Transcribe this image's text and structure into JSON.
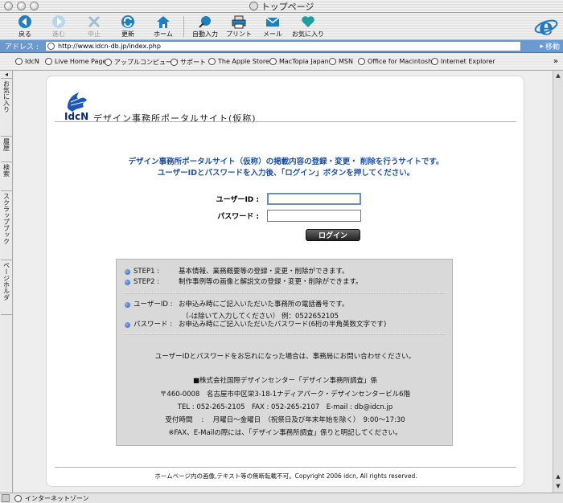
{
  "window": {
    "title": "トップページ"
  },
  "toolbar": {
    "back": "戻る",
    "forward": "進む",
    "stop": "中止",
    "refresh": "更新",
    "home": "ホーム",
    "autofill": "自動入力",
    "print": "プリント",
    "mail": "メール",
    "favorites": "お気に入り"
  },
  "address": {
    "label": "アドレス :",
    "url": "http://www.idcn-db.jp/index.php",
    "go": "移動"
  },
  "favbar": {
    "items": [
      "IdcN",
      "Live Home Page",
      "アップルコンピュータ",
      "サポート",
      "The Apple Store",
      "MacTopia Japan",
      "MSN",
      "Office for Macintosh",
      "Internet Explorer"
    ]
  },
  "sidebar": {
    "tabs": [
      "お気に入り",
      "履歴",
      "検索",
      "スクラップブック",
      "ページホルダ"
    ]
  },
  "page": {
    "logo_text": "IdcN",
    "site_name": "デザイン事務所ポータルサイト(仮称)",
    "intro_line1": "デザイン事務所ポータルサイト（仮称）の掲載内容の登録・変更・ 削除を行うサイトです。",
    "intro_line2": "ユーザーIDとパスワードを入力後、「ログイン」ボタンを押してください。",
    "form": {
      "userid_label": "ユーザーID :",
      "userid_value": "",
      "password_label": "パスワード :",
      "password_value": "",
      "login": "ログイン"
    },
    "info": {
      "step1_key": "STEP1 :",
      "step1_val": "基本情報、業務概要等の登録・変更・削除ができます。",
      "step2_key": "STEP2 :",
      "step2_val": "制作事例等の画像と解説文の登録・変更・削除ができます。",
      "uid_key": "ユーザーID :",
      "uid_val": "お申込み時にご記入いただいた事務所の電話番号です。",
      "uid_note": "（-は除いて入力してください） 例：0522652105",
      "pw_key": "パスワード :",
      "pw_val": "お申込み時にご記入いただいたパスワード(6桁の半角英数文字です)",
      "forgot": "ユーザーIDとパスワードをお忘れになった場合は、事務局にお問い合わせください。",
      "company": "■株式会社国際デザインセンター「デザイン事務所調査」係",
      "address": "〒460-0008　名古屋市中区栄3-18-1ナディアパーク・デザインセンタービル6階",
      "contact": "TEL : 052-265-2105　FAX : 052-265-2107　E-mail : db@idcn.jp",
      "hours": "受付時間　 :　 月曜日～金曜日　（祝祭日及び年末年始を除く）　9:00～17:30",
      "note": "※FAX、E-Mailの際には、「デザイン事務所調査」係りと明記してください。"
    },
    "copyright": "ホームページ内の画像,テキスト等の無断転載不可。Copyright 2006 idcn, All rights reserved."
  },
  "status": {
    "text": "インターネットゾーン"
  },
  "colors": {
    "intro": "#1f4f9c",
    "address_bar": "#6b9ad0",
    "bullet": "#2c5fb8"
  }
}
